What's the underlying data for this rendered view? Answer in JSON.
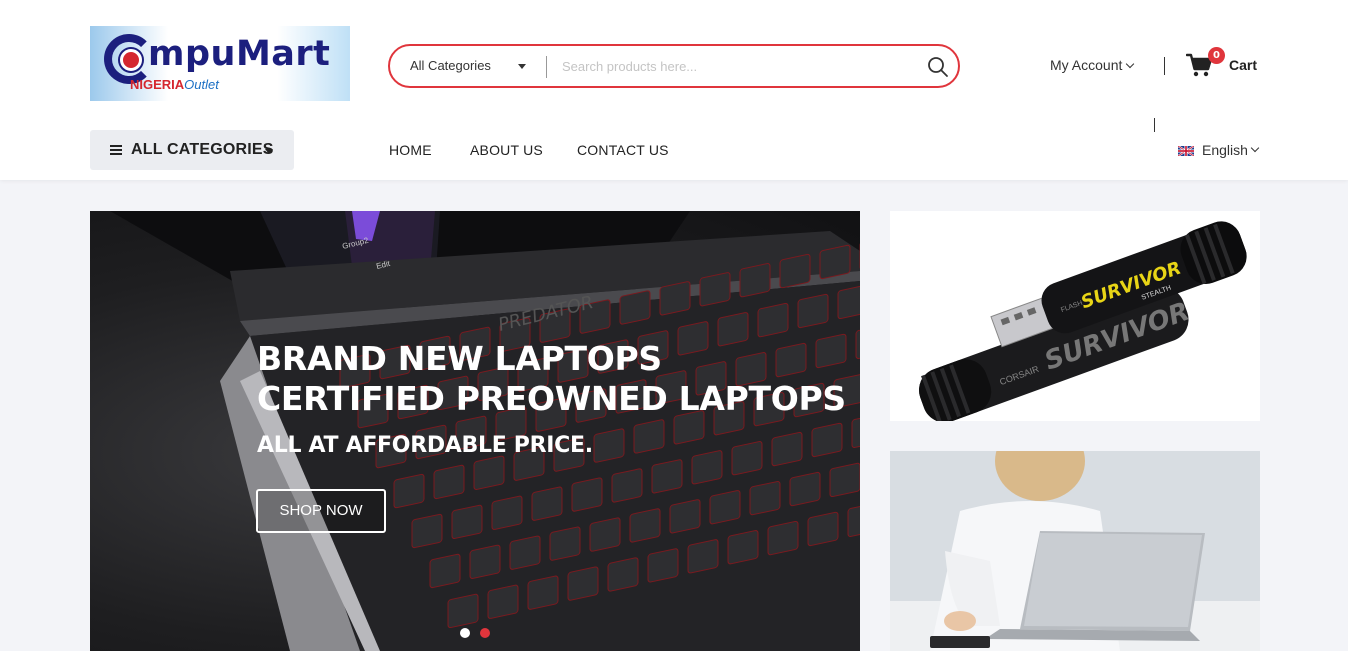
{
  "logo": {
    "main": "mpuMart",
    "sub_nigeria": "NIGERIA",
    "sub_outlet": "Outlet"
  },
  "search": {
    "category": "All Categories",
    "placeholder": "Search products here..."
  },
  "account": {
    "label": "My Account"
  },
  "cart": {
    "count": "0",
    "label": "Cart"
  },
  "nav": {
    "all_categories": "ALL CATEGORIES",
    "items": [
      "HOME",
      "ABOUT US",
      "CONTACT US"
    ]
  },
  "language": {
    "label": "English"
  },
  "hero": {
    "line1": "BRAND NEW LAPTOPS",
    "line2": "CERTIFIED PREOWNED LAPTOPS",
    "line3": "ALL AT AFFORDABLE PRICE.",
    "button": "SHOP NOW"
  },
  "banners": {
    "usb_brand": "CORSAIR",
    "usb_model": "SURVIVOR",
    "usb_sub": "STEALTH",
    "usb_flash": "FLASH"
  },
  "colors": {
    "accent": "#e0353c",
    "brand_blue": "#1c1f7e"
  }
}
